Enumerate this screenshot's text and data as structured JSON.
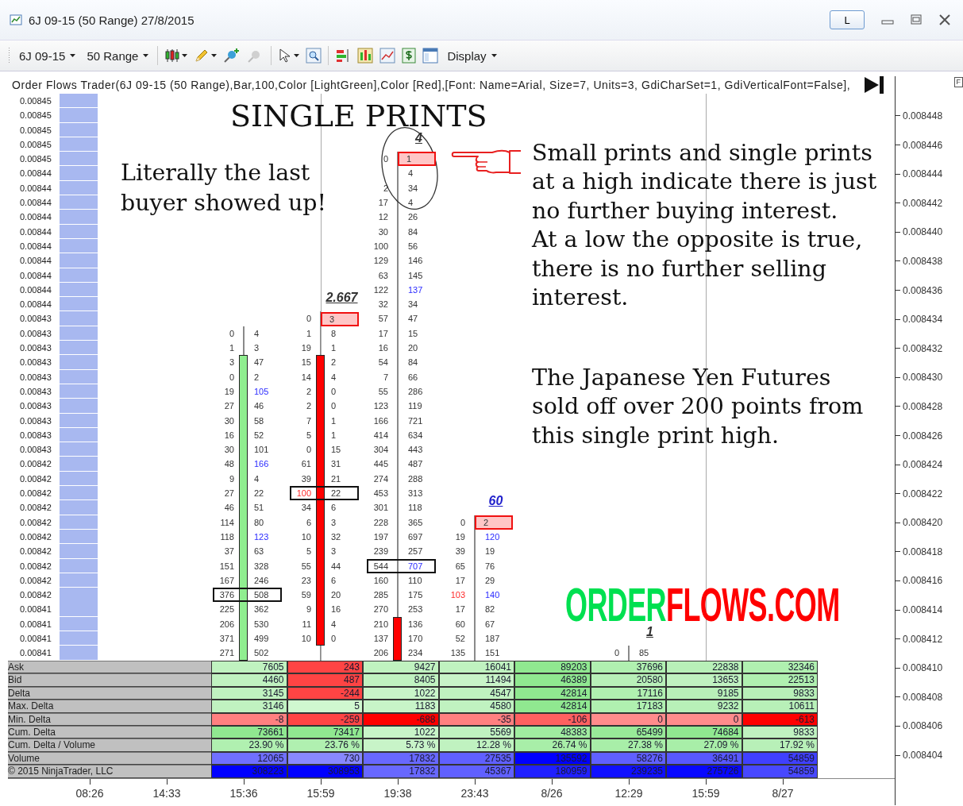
{
  "window": {
    "title": "6J 09-15 (50 Range) 27/8/2015",
    "link_button": "L"
  },
  "toolbar": {
    "instrument": "6J 09-15",
    "period": "50 Range",
    "display": "Display"
  },
  "indicator_label": "Order Flows Trader(6J 09-15 (50 Range),Bar,100,Color [LightGreen],Color [Red],[Font: Name=Arial, Size=7, Units=3, GdiCharSet=1, GdiVerticalFont=False],",
  "corner_button": "F",
  "price_ladder": [
    "0.00845",
    "0.00845",
    "0.00845",
    "0.00845",
    "0.00845",
    "0.00844",
    "0.00844",
    "0.00844",
    "0.00844",
    "0.00844",
    "0.00844",
    "0.00844",
    "0.00844",
    "0.00844",
    "0.00844",
    "0.00843",
    "0.00843",
    "0.00843",
    "0.00843",
    "0.00843",
    "0.00843",
    "0.00843",
    "0.00843",
    "0.00843",
    "0.00843",
    "0.00842",
    "0.00842",
    "0.00842",
    "0.00842",
    "0.00842",
    "0.00842",
    "0.00842",
    "0.00842",
    "0.00842",
    "0.00842",
    "0.00841",
    "0.00841",
    "0.00841",
    "0.00841"
  ],
  "price_axis": [
    "0.008448",
    "0.008446",
    "0.008444",
    "0.008442",
    "0.008440",
    "0.008438",
    "0.008436",
    "0.008434",
    "0.008432",
    "0.008430",
    "0.008428",
    "0.008426",
    "0.008424",
    "0.008422",
    "0.008420",
    "0.008418",
    "0.008416",
    "0.008414",
    "0.008412",
    "0.008410",
    "0.008408",
    "0.008406",
    "0.008404"
  ],
  "bars": [
    {
      "rising": true,
      "rows": [
        null,
        null,
        null,
        null,
        null,
        null,
        null,
        null,
        null,
        null,
        null,
        null,
        null,
        null,
        null,
        null,
        {
          "bid": "0",
          "ask": "4",
          "bid_imb": false,
          "ask_imb": false,
          "single_print": false,
          "boxed": false,
          "body_edge": false
        },
        {
          "bid": "1",
          "ask": "3",
          "bid_imb": false,
          "ask_imb": false,
          "single_print": false,
          "boxed": false,
          "body_edge": false
        },
        {
          "bid": "3",
          "ask": "47",
          "bid_imb": false,
          "ask_imb": false,
          "single_print": false,
          "boxed": false,
          "body_edge": true
        },
        {
          "bid": "0",
          "ask": "2",
          "bid_imb": false,
          "ask_imb": false,
          "single_print": false,
          "boxed": false,
          "body_edge": false
        },
        {
          "bid": "19",
          "ask": "105",
          "bid_imb": false,
          "ask_imb": true,
          "single_print": false,
          "boxed": false,
          "body_edge": false
        },
        {
          "bid": "27",
          "ask": "46",
          "bid_imb": false,
          "ask_imb": false,
          "single_print": false,
          "boxed": false,
          "body_edge": false
        },
        {
          "bid": "30",
          "ask": "58",
          "bid_imb": false,
          "ask_imb": false,
          "single_print": false,
          "boxed": false,
          "body_edge": false
        },
        {
          "bid": "16",
          "ask": "52",
          "bid_imb": false,
          "ask_imb": false,
          "single_print": false,
          "boxed": false,
          "body_edge": false
        },
        {
          "bid": "30",
          "ask": "101",
          "bid_imb": false,
          "ask_imb": false,
          "single_print": false,
          "boxed": false,
          "body_edge": false
        },
        {
          "bid": "48",
          "ask": "166",
          "bid_imb": false,
          "ask_imb": true,
          "single_print": false,
          "boxed": false,
          "body_edge": false
        },
        {
          "bid": "9",
          "ask": "4",
          "bid_imb": false,
          "ask_imb": false,
          "single_print": false,
          "boxed": false,
          "body_edge": false
        },
        {
          "bid": "27",
          "ask": "22",
          "bid_imb": false,
          "ask_imb": false,
          "single_print": false,
          "boxed": false,
          "body_edge": false
        },
        {
          "bid": "46",
          "ask": "51",
          "bid_imb": false,
          "ask_imb": false,
          "single_print": false,
          "boxed": false,
          "body_edge": false
        },
        {
          "bid": "114",
          "ask": "80",
          "bid_imb": false,
          "ask_imb": false,
          "single_print": false,
          "boxed": false,
          "body_edge": false
        },
        {
          "bid": "118",
          "ask": "123",
          "bid_imb": false,
          "ask_imb": true,
          "single_print": false,
          "boxed": false,
          "body_edge": false
        },
        {
          "bid": "37",
          "ask": "63",
          "bid_imb": false,
          "ask_imb": false,
          "single_print": false,
          "boxed": false,
          "body_edge": false
        },
        {
          "bid": "151",
          "ask": "328",
          "bid_imb": false,
          "ask_imb": false,
          "single_print": false,
          "boxed": false,
          "body_edge": false
        },
        {
          "bid": "167",
          "ask": "246",
          "bid_imb": false,
          "ask_imb": false,
          "single_print": false,
          "boxed": false,
          "body_edge": false
        },
        {
          "bid": "376",
          "ask": "508",
          "bid_imb": false,
          "ask_imb": false,
          "single_print": false,
          "boxed": true,
          "body_edge": false
        },
        {
          "bid": "225",
          "ask": "362",
          "bid_imb": false,
          "ask_imb": false,
          "single_print": false,
          "boxed": false,
          "body_edge": false
        },
        {
          "bid": "206",
          "ask": "530",
          "bid_imb": false,
          "ask_imb": false,
          "single_print": false,
          "boxed": false,
          "body_edge": false
        },
        {
          "bid": "371",
          "ask": "499",
          "bid_imb": false,
          "ask_imb": false,
          "single_print": false,
          "boxed": false,
          "body_edge": false
        },
        {
          "bid": "271",
          "ask": "502",
          "bid_imb": false,
          "ask_imb": false,
          "single_print": false,
          "boxed": false,
          "body_edge": false
        }
      ],
      "stats": [
        {
          "value": "7605",
          "color": "#c0f2c0"
        },
        {
          "value": "4460",
          "color": "#c0f2c0"
        },
        {
          "value": "3145",
          "color": "#c0f2c0"
        },
        {
          "value": "3146",
          "color": "#c0f2c0"
        },
        {
          "value": "-8",
          "color": "#ff8080"
        },
        {
          "value": "73661",
          "color": "#90e890"
        },
        {
          "value": "23.90 %",
          "color": "#b0f0b0"
        },
        {
          "value": "12065",
          "color": "#7070ff"
        },
        {
          "value": "308223",
          "color": "#0000ff"
        }
      ]
    },
    {
      "label": "2.667",
      "color": "#333333",
      "rising": false,
      "rows": [
        null,
        null,
        null,
        null,
        null,
        null,
        null,
        null,
        null,
        null,
        null,
        null,
        null,
        null,
        null,
        {
          "bid": "0",
          "ask": "3",
          "bid_imb": false,
          "ask_imb": false,
          "single_print": true,
          "boxed": false,
          "body_edge": false
        },
        {
          "bid": "1",
          "ask": "8",
          "bid_imb": false,
          "ask_imb": false,
          "single_print": false,
          "boxed": false,
          "body_edge": false
        },
        {
          "bid": "19",
          "ask": "1",
          "bid_imb": false,
          "ask_imb": false,
          "single_print": false,
          "boxed": false,
          "body_edge": false
        },
        {
          "bid": "15",
          "ask": "2",
          "bid_imb": false,
          "ask_imb": false,
          "single_print": false,
          "boxed": false,
          "body_edge": true
        },
        {
          "bid": "14",
          "ask": "4",
          "bid_imb": false,
          "ask_imb": false,
          "single_print": false,
          "boxed": false,
          "body_edge": false
        },
        {
          "bid": "2",
          "ask": "0",
          "bid_imb": false,
          "ask_imb": false,
          "single_print": false,
          "boxed": false,
          "body_edge": false
        },
        {
          "bid": "2",
          "ask": "0",
          "bid_imb": false,
          "ask_imb": false,
          "single_print": false,
          "boxed": false,
          "body_edge": false
        },
        {
          "bid": "7",
          "ask": "1",
          "bid_imb": false,
          "ask_imb": false,
          "single_print": false,
          "boxed": false,
          "body_edge": false
        },
        {
          "bid": "5",
          "ask": "1",
          "bid_imb": false,
          "ask_imb": false,
          "single_print": false,
          "boxed": false,
          "body_edge": false
        },
        {
          "bid": "0",
          "ask": "15",
          "bid_imb": false,
          "ask_imb": false,
          "single_print": false,
          "boxed": false,
          "body_edge": false
        },
        {
          "bid": "61",
          "ask": "31",
          "bid_imb": false,
          "ask_imb": false,
          "single_print": false,
          "boxed": false,
          "body_edge": false
        },
        {
          "bid": "39",
          "ask": "21",
          "bid_imb": false,
          "ask_imb": false,
          "single_print": false,
          "boxed": false,
          "body_edge": false
        },
        {
          "bid": "100",
          "ask": "22",
          "bid_imb": true,
          "ask_imb": false,
          "single_print": false,
          "boxed": true,
          "body_edge": false
        },
        {
          "bid": "34",
          "ask": "6",
          "bid_imb": false,
          "ask_imb": false,
          "single_print": false,
          "boxed": false,
          "body_edge": false
        },
        {
          "bid": "6",
          "ask": "3",
          "bid_imb": false,
          "ask_imb": false,
          "single_print": false,
          "boxed": false,
          "body_edge": false
        },
        {
          "bid": "10",
          "ask": "32",
          "bid_imb": false,
          "ask_imb": false,
          "single_print": false,
          "boxed": false,
          "body_edge": false
        },
        {
          "bid": "5",
          "ask": "3",
          "bid_imb": false,
          "ask_imb": false,
          "single_print": false,
          "boxed": false,
          "body_edge": false
        },
        {
          "bid": "55",
          "ask": "44",
          "bid_imb": false,
          "ask_imb": false,
          "single_print": false,
          "boxed": false,
          "body_edge": false
        },
        {
          "bid": "23",
          "ask": "6",
          "bid_imb": false,
          "ask_imb": false,
          "single_print": false,
          "boxed": false,
          "body_edge": false
        },
        {
          "bid": "59",
          "ask": "20",
          "bid_imb": false,
          "ask_imb": false,
          "single_print": false,
          "boxed": false,
          "body_edge": false
        },
        {
          "bid": "9",
          "ask": "16",
          "bid_imb": false,
          "ask_imb": false,
          "single_print": false,
          "boxed": false,
          "body_edge": false
        },
        {
          "bid": "11",
          "ask": "4",
          "bid_imb": false,
          "ask_imb": false,
          "single_print": false,
          "boxed": false,
          "body_edge": false
        },
        {
          "bid": "10",
          "ask": "0",
          "bid_imb": false,
          "ask_imb": false,
          "single_print": false,
          "boxed": false,
          "body_edge": true
        }
      ],
      "stats": [
        {
          "value": "243",
          "color": "#ff4444"
        },
        {
          "value": "487",
          "color": "#ff4444"
        },
        {
          "value": "-244",
          "color": "#ff4444"
        },
        {
          "value": "5",
          "color": "#d0f8d0"
        },
        {
          "value": "-259",
          "color": "#ff4444"
        },
        {
          "value": "73417",
          "color": "#90e890"
        },
        {
          "value": "23.76 %",
          "color": "#b0f0b0"
        },
        {
          "value": "730",
          "color": "#8888ff"
        },
        {
          "value": "308953",
          "color": "#0000ff"
        }
      ]
    },
    {
      "label": "4",
      "color": "#333333",
      "rising": false,
      "rows": [
        null,
        null,
        null,
        null,
        {
          "bid": "0",
          "ask": "1",
          "bid_imb": false,
          "ask_imb": false,
          "single_print": true,
          "boxed": false,
          "body_edge": false
        },
        {
          "ask": "4",
          "ask_imb": false,
          "single_print": false,
          "boxed": false,
          "body_edge": false
        },
        {
          "bid": "2",
          "ask": "34",
          "bid_imb": false,
          "ask_imb": false,
          "single_print": false,
          "boxed": false,
          "body_edge": false
        },
        {
          "bid": "17",
          "ask": "4",
          "bid_imb": false,
          "ask_imb": false,
          "single_print": false,
          "boxed": false,
          "body_edge": false
        },
        {
          "bid": "12",
          "ask": "26",
          "bid_imb": false,
          "ask_imb": false,
          "single_print": false,
          "boxed": false,
          "body_edge": false
        },
        {
          "bid": "30",
          "ask": "84",
          "bid_imb": false,
          "ask_imb": false,
          "single_print": false,
          "boxed": false,
          "body_edge": false
        },
        {
          "bid": "100",
          "ask": "56",
          "bid_imb": false,
          "ask_imb": false,
          "single_print": false,
          "boxed": false,
          "body_edge": false
        },
        {
          "bid": "129",
          "ask": "146",
          "bid_imb": false,
          "ask_imb": false,
          "single_print": false,
          "boxed": false,
          "body_edge": false
        },
        {
          "bid": "63",
          "ask": "145",
          "bid_imb": false,
          "ask_imb": false,
          "single_print": false,
          "boxed": false,
          "body_edge": false
        },
        {
          "bid": "122",
          "ask": "137",
          "bid_imb": false,
          "ask_imb": true,
          "single_print": false,
          "boxed": false,
          "body_edge": false
        },
        {
          "bid": "32",
          "ask": "34",
          "bid_imb": false,
          "ask_imb": false,
          "single_print": false,
          "boxed": false,
          "body_edge": false
        },
        {
          "bid": "57",
          "ask": "47",
          "bid_imb": false,
          "ask_imb": false,
          "single_print": false,
          "boxed": false,
          "body_edge": false
        },
        {
          "bid": "17",
          "ask": "15",
          "bid_imb": false,
          "ask_imb": false,
          "single_print": false,
          "boxed": false,
          "body_edge": false
        },
        {
          "bid": "16",
          "ask": "20",
          "bid_imb": false,
          "ask_imb": false,
          "single_print": false,
          "boxed": false,
          "body_edge": false
        },
        {
          "bid": "54",
          "ask": "84",
          "bid_imb": false,
          "ask_imb": false,
          "single_print": false,
          "boxed": false,
          "body_edge": false
        },
        {
          "bid": "7",
          "ask": "66",
          "bid_imb": false,
          "ask_imb": false,
          "single_print": false,
          "boxed": false,
          "body_edge": false
        },
        {
          "bid": "55",
          "ask": "286",
          "bid_imb": false,
          "ask_imb": false,
          "single_print": false,
          "boxed": false,
          "body_edge": false
        },
        {
          "bid": "123",
          "ask": "119",
          "bid_imb": false,
          "ask_imb": false,
          "single_print": false,
          "boxed": false,
          "body_edge": false
        },
        {
          "bid": "166",
          "ask": "721",
          "bid_imb": false,
          "ask_imb": false,
          "single_print": false,
          "boxed": false,
          "body_edge": false
        },
        {
          "bid": "414",
          "ask": "634",
          "bid_imb": false,
          "ask_imb": false,
          "single_print": false,
          "boxed": false,
          "body_edge": false
        },
        {
          "bid": "304",
          "ask": "443",
          "bid_imb": false,
          "ask_imb": false,
          "single_print": false,
          "boxed": false,
          "body_edge": false
        },
        {
          "bid": "445",
          "ask": "487",
          "bid_imb": false,
          "ask_imb": false,
          "single_print": false,
          "boxed": false,
          "body_edge": false
        },
        {
          "bid": "274",
          "ask": "288",
          "bid_imb": false,
          "ask_imb": false,
          "single_print": false,
          "boxed": false,
          "body_edge": false
        },
        {
          "bid": "453",
          "ask": "313",
          "bid_imb": false,
          "ask_imb": false,
          "single_print": false,
          "boxed": false,
          "body_edge": false
        },
        {
          "bid": "301",
          "ask": "118",
          "bid_imb": false,
          "ask_imb": false,
          "single_print": false,
          "boxed": false,
          "body_edge": false
        },
        {
          "bid": "228",
          "ask": "365",
          "bid_imb": false,
          "ask_imb": false,
          "single_print": false,
          "boxed": false,
          "body_edge": false
        },
        {
          "bid": "197",
          "ask": "697",
          "bid_imb": false,
          "ask_imb": false,
          "single_print": false,
          "boxed": false,
          "body_edge": false
        },
        {
          "bid": "239",
          "ask": "257",
          "bid_imb": false,
          "ask_imb": false,
          "single_print": false,
          "boxed": false,
          "body_edge": false
        },
        {
          "bid": "544",
          "ask": "707",
          "bid_imb": false,
          "ask_imb": true,
          "single_print": false,
          "boxed": true,
          "body_edge": false
        },
        {
          "bid": "160",
          "ask": "110",
          "bid_imb": false,
          "ask_imb": false,
          "single_print": false,
          "boxed": false,
          "body_edge": false
        },
        {
          "bid": "285",
          "ask": "175",
          "bid_imb": false,
          "ask_imb": false,
          "single_print": false,
          "boxed": false,
          "body_edge": false
        },
        {
          "bid": "270",
          "ask": "253",
          "bid_imb": false,
          "ask_imb": false,
          "single_print": false,
          "boxed": false,
          "body_edge": false
        },
        {
          "bid": "210",
          "ask": "136",
          "bid_imb": false,
          "ask_imb": false,
          "single_print": false,
          "boxed": false,
          "body_edge": true
        },
        {
          "bid": "137",
          "ask": "170",
          "bid_imb": false,
          "ask_imb": false,
          "single_print": false,
          "boxed": false,
          "body_edge": false
        },
        {
          "bid": "206",
          "ask": "234",
          "bid_imb": false,
          "ask_imb": false,
          "single_print": false,
          "boxed": false,
          "body_edge": false
        }
      ],
      "stats": [
        {
          "value": "9427",
          "color": "#c0f2c0"
        },
        {
          "value": "8405",
          "color": "#c0f2c0"
        },
        {
          "value": "1022",
          "color": "#c8f4c8"
        },
        {
          "value": "1183",
          "color": "#c8f4c8"
        },
        {
          "value": "-688",
          "color": "#ff0000"
        },
        {
          "value": "1022",
          "color": "#c8f4c8"
        },
        {
          "value": "5.73 %",
          "color": "#c8f4c8"
        },
        {
          "value": "17832",
          "color": "#6868ff"
        },
        {
          "value": "17832",
          "color": "#6868ff"
        }
      ]
    },
    {
      "label": "60",
      "color": "#2222cc",
      "rows": [
        null,
        null,
        null,
        null,
        null,
        null,
        null,
        null,
        null,
        null,
        null,
        null,
        null,
        null,
        null,
        null,
        null,
        null,
        null,
        null,
        null,
        null,
        null,
        null,
        null,
        null,
        null,
        null,
        null,
        {
          "bid": "0",
          "ask": "2",
          "bid_imb": false,
          "ask_imb": false,
          "single_print": true,
          "boxed": false,
          "body_edge": false
        },
        {
          "bid": "19",
          "ask": "120",
          "bid_imb": false,
          "ask_imb": true,
          "single_print": false,
          "boxed": false,
          "body_edge": false
        },
        {
          "bid": "39",
          "ask": "19",
          "bid_imb": false,
          "ask_imb": false,
          "single_print": false,
          "boxed": false,
          "body_edge": false
        },
        {
          "bid": "65",
          "ask": "76",
          "bid_imb": false,
          "ask_imb": false,
          "single_print": false,
          "boxed": false,
          "body_edge": false
        },
        {
          "bid": "17",
          "ask": "29",
          "bid_imb": false,
          "ask_imb": false,
          "single_print": false,
          "boxed": false,
          "body_edge": false
        },
        {
          "bid": "103",
          "ask": "140",
          "bid_imb": true,
          "ask_imb": true,
          "single_print": false,
          "boxed": false,
          "body_edge": false
        },
        {
          "bid": "17",
          "ask": "82",
          "bid_imb": false,
          "ask_imb": false,
          "single_print": false,
          "boxed": false,
          "body_edge": false
        },
        {
          "bid": "60",
          "ask": "67",
          "bid_imb": false,
          "ask_imb": false,
          "single_print": false,
          "boxed": false,
          "body_edge": false
        },
        {
          "bid": "52",
          "ask": "187",
          "bid_imb": false,
          "ask_imb": false,
          "single_print": false,
          "boxed": false,
          "body_edge": false
        },
        {
          "bid": "135",
          "ask": "151",
          "bid_imb": false,
          "ask_imb": false,
          "single_print": false,
          "boxed": false,
          "body_edge": false
        }
      ],
      "stats": [
        {
          "value": "16041",
          "color": "#c0f2c0"
        },
        {
          "value": "11494",
          "color": "#c8f4c8"
        },
        {
          "value": "4547",
          "color": "#c0f2c0"
        },
        {
          "value": "4580",
          "color": "#c0f2c0"
        },
        {
          "value": "-35",
          "color": "#ff8080"
        },
        {
          "value": "5569",
          "color": "#c0f2c0"
        },
        {
          "value": "12.28 %",
          "color": "#c0f2c0"
        },
        {
          "value": "27535",
          "color": "#6060ff"
        },
        {
          "value": "45367",
          "color": "#6060ff"
        }
      ]
    },
    {
      "stats": [
        {
          "value": "89203",
          "color": "#90e890"
        },
        {
          "value": "46389",
          "color": "#90e890"
        },
        {
          "value": "42814",
          "color": "#90e890"
        },
        {
          "value": "42814",
          "color": "#90e890"
        },
        {
          "value": "-106",
          "color": "#ff6060"
        },
        {
          "value": "48383",
          "color": "#a0eca0"
        },
        {
          "value": "26.74 %",
          "color": "#a8eea8"
        },
        {
          "value": "135592",
          "color": "#0000ff"
        },
        {
          "value": "180959",
          "color": "#2020ff"
        }
      ]
    },
    {
      "label": "1",
      "color": "#333333",
      "rows": [
        null,
        null,
        null,
        null,
        null,
        null,
        null,
        null,
        null,
        null,
        null,
        null,
        null,
        null,
        null,
        null,
        null,
        null,
        null,
        null,
        null,
        null,
        null,
        null,
        null,
        null,
        null,
        null,
        null,
        null,
        null,
        null,
        null,
        null,
        null,
        null,
        null,
        null,
        {
          "bid": "0",
          "ask": "85",
          "bid_imb": false,
          "ask_imb": false,
          "single_print": false,
          "boxed": false,
          "body_edge": false
        }
      ],
      "stats": [
        {
          "value": "37696",
          "color": "#b0f0b0"
        },
        {
          "value": "20580",
          "color": "#b8f0b8"
        },
        {
          "value": "17116",
          "color": "#b0f0b0"
        },
        {
          "value": "17183",
          "color": "#b0f0b0"
        },
        {
          "value": "0",
          "color": "#ff8c8c"
        },
        {
          "value": "65499",
          "color": "#98ea98"
        },
        {
          "value": "27.38 %",
          "color": "#a8eea8"
        },
        {
          "value": "58276",
          "color": "#6060ff"
        },
        {
          "value": "239235",
          "color": "#1010ff"
        }
      ]
    },
    {
      "stats": [
        {
          "value": "22838",
          "color": "#b8f0b8"
        },
        {
          "value": "13653",
          "color": "#c0f2c0"
        },
        {
          "value": "9185",
          "color": "#b8f0b8"
        },
        {
          "value": "9232",
          "color": "#b8f0b8"
        },
        {
          "value": "0",
          "color": "#ff8c8c"
        },
        {
          "value": "74684",
          "color": "#90e890"
        },
        {
          "value": "27.09 %",
          "color": "#a8eea8"
        },
        {
          "value": "36491",
          "color": "#5858ff"
        },
        {
          "value": "275726",
          "color": "#0808ff"
        }
      ]
    },
    {
      "stats": [
        {
          "value": "32346",
          "color": "#b0f0b0"
        },
        {
          "value": "22513",
          "color": "#b0f0b0"
        },
        {
          "value": "9833",
          "color": "#b8f0b8"
        },
        {
          "value": "10611",
          "color": "#b8f0b8"
        },
        {
          "value": "-613",
          "color": "#ff0000"
        },
        {
          "value": "9833",
          "color": "#c0f2c0"
        },
        {
          "value": "17.92 %",
          "color": "#b8f0b8"
        },
        {
          "value": "54859",
          "color": "#4040ff"
        },
        {
          "value": "54859",
          "color": "#4848ff"
        }
      ]
    }
  ],
  "stats_labels": [
    "Ask",
    "Bid",
    "Delta",
    "Max. Delta",
    "Min. Delta",
    "Cum. Delta",
    "Cum. Delta / Volume",
    "Volume"
  ],
  "stats_footer": "© 2015 NinjaTrader, LLC",
  "annotations": {
    "headline": "SINGLE PRINTS",
    "left_note": "Literally the last buyer showed up!",
    "right_note": "Small prints and single prints at a high indicate there is just no further buying interest.\nAt a low the opposite is true, there is no further selling interest.",
    "bottom_note": "The Japanese Yen Futures sold off over 200 points from this single print high."
  },
  "logo": [
    {
      "text": "ORDER",
      "color": "#00e050"
    },
    {
      "text": "FLOWS.COM",
      "color": "#ff0000"
    }
  ],
  "time_axis": [
    {
      "label": "08:26",
      "session_break": false
    },
    {
      "label": "14:33",
      "session_break": false
    },
    {
      "label": "15:36",
      "session_break": false
    },
    {
      "label": "15:59",
      "session_break": true
    },
    {
      "label": "19:38",
      "session_break": false
    },
    {
      "label": "23:43",
      "session_break": false
    },
    {
      "label": "8/26",
      "session_break": false
    },
    {
      "label": "12:29",
      "session_break": false
    },
    {
      "label": "15:59",
      "session_break": true
    },
    {
      "label": "8/27",
      "session_break": false
    }
  ]
}
